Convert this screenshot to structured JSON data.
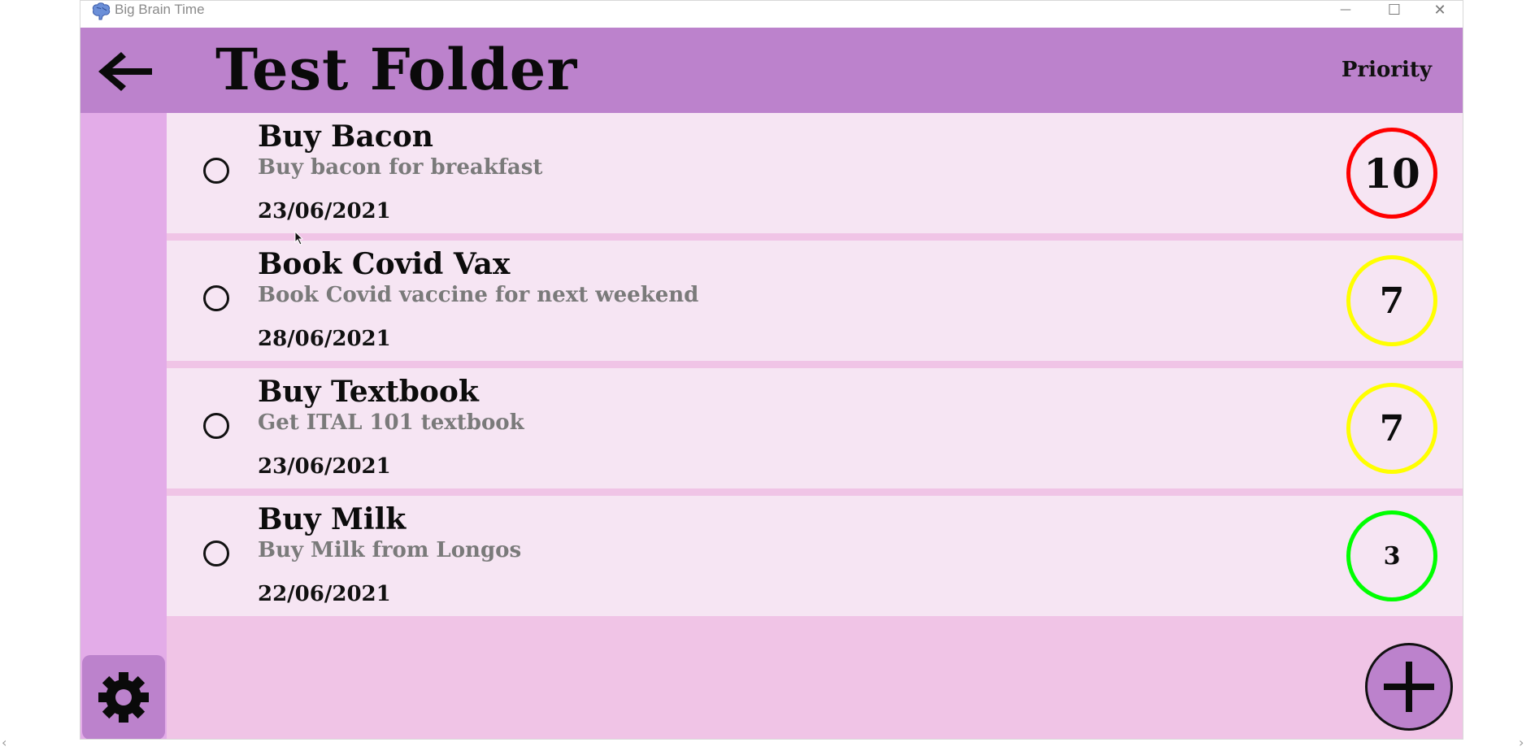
{
  "window": {
    "title": "Big Brain Time",
    "icon": "brain-icon",
    "controls": {
      "minimize": "—",
      "maximize": "☐",
      "close": "✕"
    }
  },
  "header": {
    "back_icon": "arrow-left-icon",
    "title": "Test Folder",
    "sort_label": "Priority"
  },
  "tasks": [
    {
      "title": "Buy Bacon",
      "description": "Buy bacon for breakfast",
      "date": "23/06/2021",
      "priority": "10",
      "priority_color": "#ff0000",
      "completed": false
    },
    {
      "title": "Book Covid Vax",
      "description": "Book Covid vaccine for next weekend",
      "date": "28/06/2021",
      "priority": "7",
      "priority_color": "#ffff00",
      "completed": false
    },
    {
      "title": "Buy Textbook",
      "description": "Get ITAL 101 textbook",
      "date": "23/06/2021",
      "priority": "7",
      "priority_color": "#ffff00",
      "completed": false
    },
    {
      "title": "Buy Milk",
      "description": "Buy Milk from Longos",
      "date": "22/06/2021",
      "priority": "3",
      "priority_color": "#00ff00",
      "completed": false
    }
  ],
  "footer": {
    "settings_icon": "gear-icon",
    "add_icon": "plus-icon"
  },
  "colors": {
    "header": "#bc82cc",
    "sidebar": "#e3ace8",
    "row": "#f6e5f3",
    "background": "#f0c4e6"
  }
}
